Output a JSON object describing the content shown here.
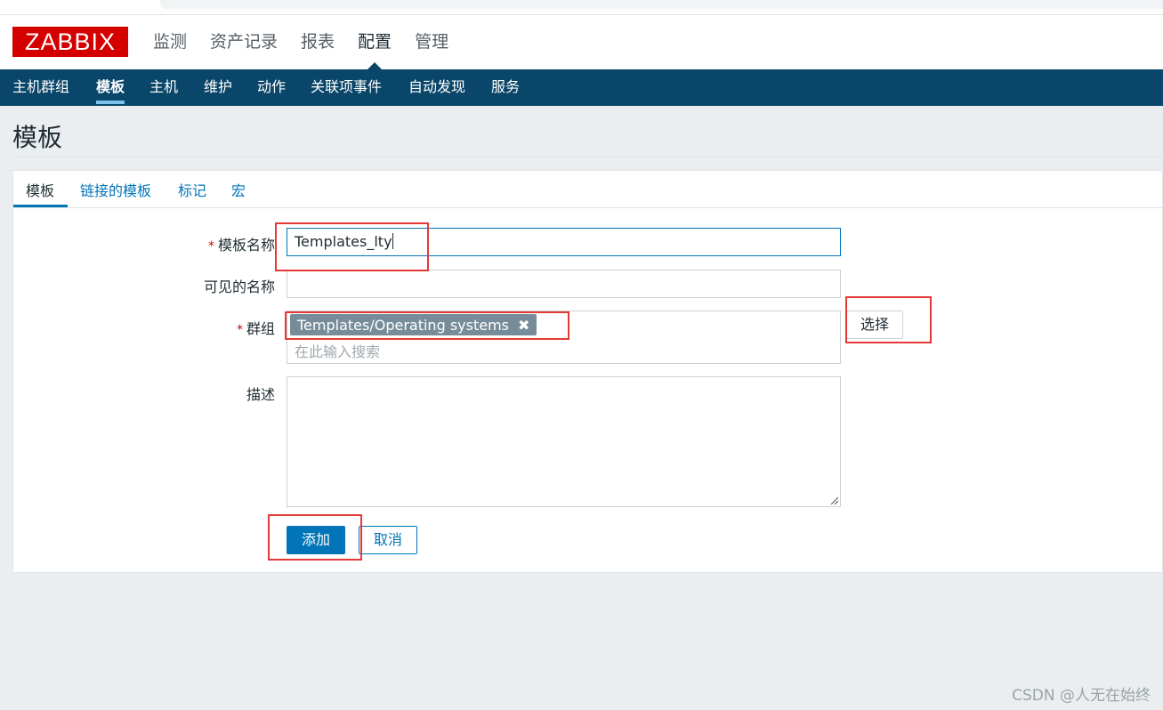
{
  "logo": {
    "text": "ZABBIX"
  },
  "main_menu": [
    "监测",
    "资产记录",
    "报表",
    "配置",
    "管理"
  ],
  "sub_menu": [
    "主机群组",
    "模板",
    "主机",
    "维护",
    "动作",
    "关联项事件",
    "自动发现",
    "服务"
  ],
  "page": {
    "title": "模板"
  },
  "tabs": [
    "模板",
    "链接的模板",
    "标记",
    "宏"
  ],
  "form": {
    "template_name": {
      "label": "模板名称",
      "value": "Templates_lty"
    },
    "visible_name": {
      "label": "可见的名称",
      "value": ""
    },
    "groups": {
      "label": "群组",
      "tag": "Templates/Operating systems",
      "placeholder": "在此输入搜索",
      "select_label": "选择"
    },
    "description": {
      "label": "描述",
      "value": ""
    },
    "required_marker": "*",
    "add_label": "添加",
    "cancel_label": "取消"
  },
  "watermark": "CSDN @人无在始终",
  "colors": {
    "brand": "#d40000",
    "nav": "#0a466a",
    "primary": "#0275b8",
    "tag": "#768d99",
    "highlight": "#e53935"
  }
}
